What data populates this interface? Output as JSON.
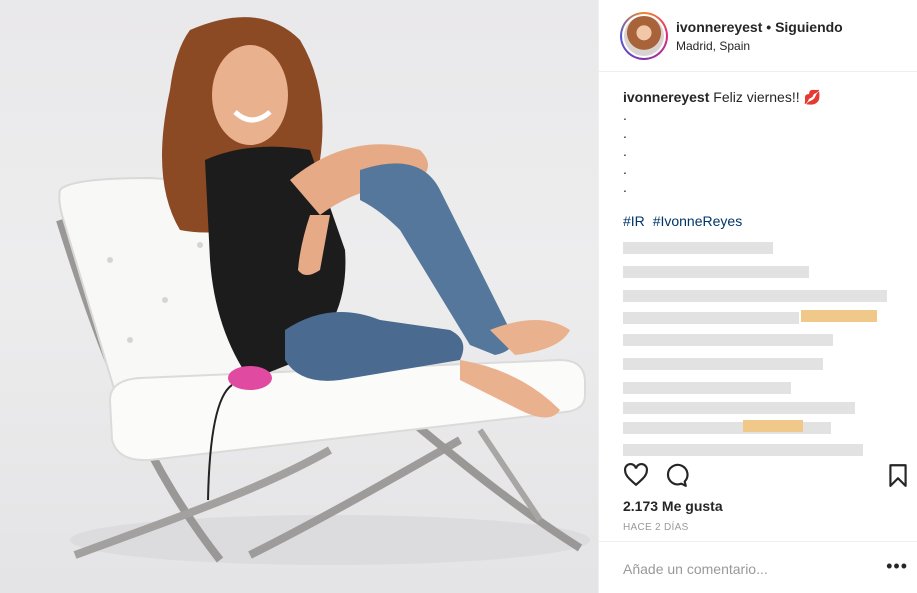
{
  "post": {
    "username": "ivonnereyest",
    "separator": "•",
    "follow_status": "Siguiendo",
    "location": "Madrid, Spain",
    "caption_text": "Feliz viernes!! 💋",
    "caption_dots": [
      ".",
      ".",
      ".",
      ".",
      "."
    ],
    "hashtags": [
      "#IR",
      "#IvonneReyes"
    ],
    "likes": "2.173 Me gusta",
    "time": "HACE 2 DÍAS"
  },
  "icons": {
    "like": "heart-icon",
    "comment": "comment-bubble-icon",
    "save": "bookmark-icon",
    "more": "more-options-icon"
  },
  "comment_box": {
    "placeholder": "Añade un comentario..."
  },
  "more_glyph": "•••",
  "colors": {
    "hashtag": "#003569",
    "secondary_text": "#999999",
    "primary_text": "#262626",
    "divider": "#efefef"
  }
}
